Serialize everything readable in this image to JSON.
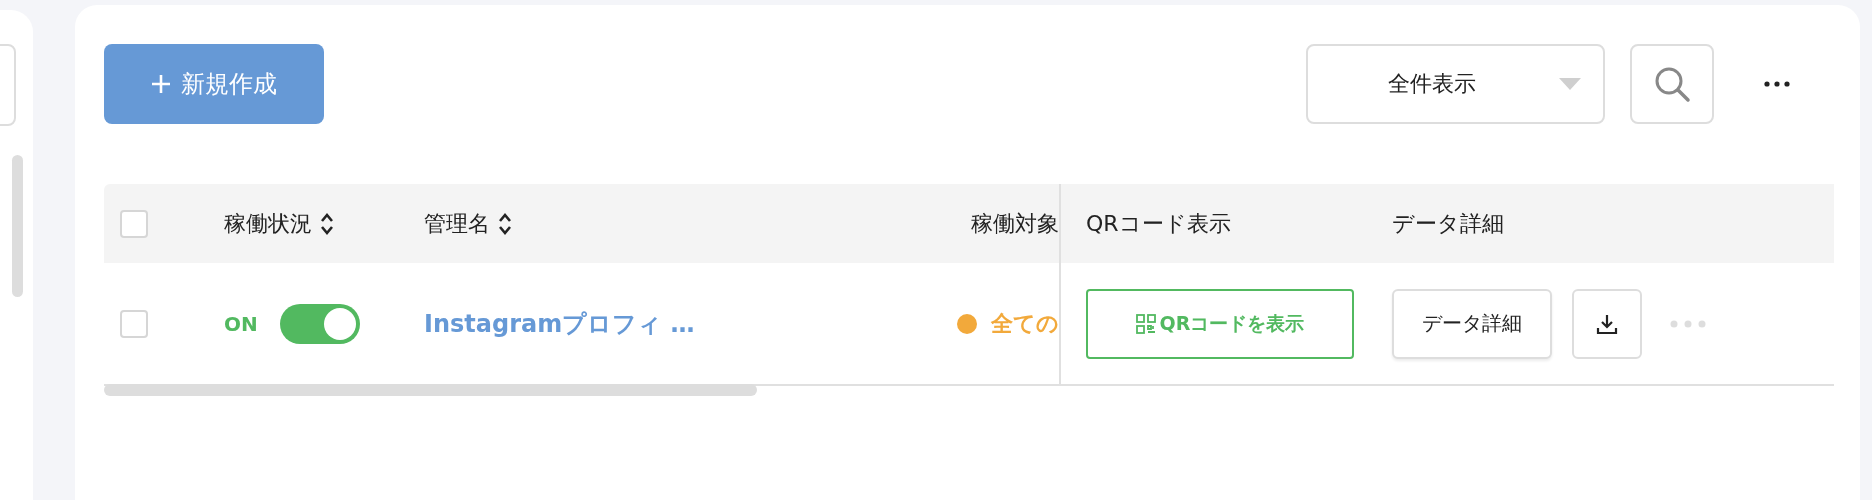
{
  "toolbar": {
    "new_button": {
      "label": "新規作成"
    },
    "filter": {
      "value": "全件表示"
    }
  },
  "table": {
    "columns": [
      {
        "label": "稼働状況",
        "sortable": true
      },
      {
        "label": "管理名",
        "sortable": true
      },
      {
        "label": "稼働対象",
        "sortable": false
      },
      {
        "label": "QRコード表示",
        "sortable": false
      },
      {
        "label": "データ詳細",
        "sortable": false
      }
    ],
    "header_checked": false,
    "rows": [
      {
        "checked": false,
        "status": {
          "label": "ON",
          "on": true
        },
        "name": "Instagramプロフィ …",
        "target": {
          "label": "全ての",
          "color": "#f2a93b"
        },
        "qr_button": "QRコードを表示",
        "detail_button": "データ詳細"
      }
    ]
  }
}
